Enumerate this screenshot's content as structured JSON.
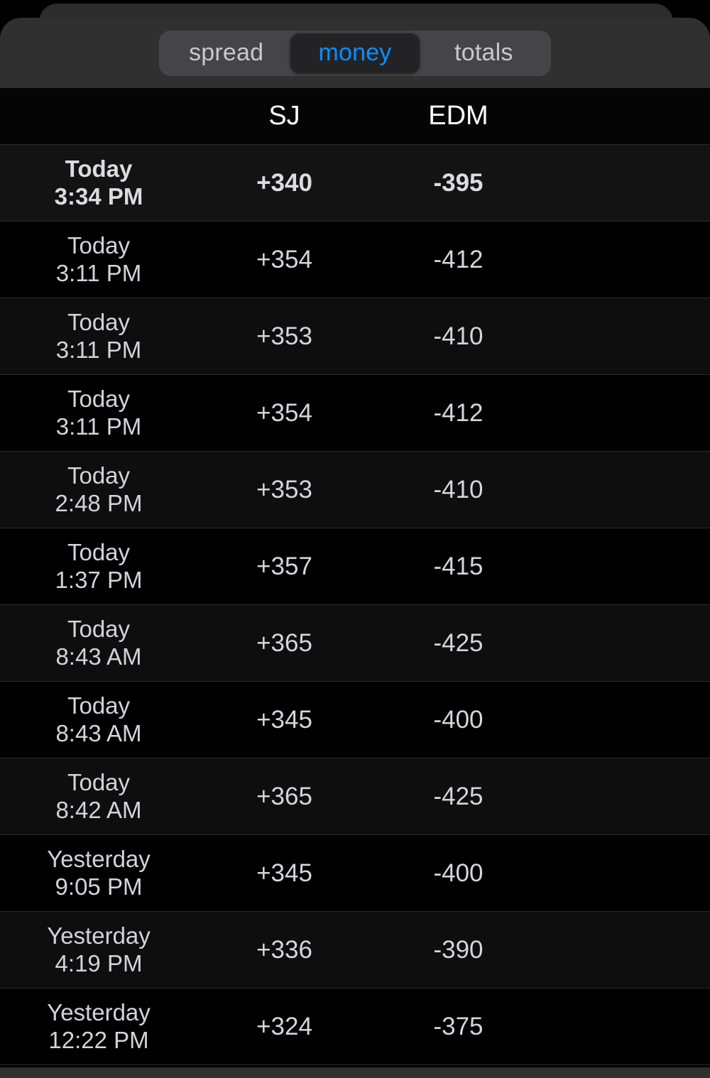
{
  "segmented_control": {
    "options": [
      {
        "label": "spread",
        "selected": false
      },
      {
        "label": "money",
        "selected": true
      },
      {
        "label": "totals",
        "selected": false
      }
    ],
    "selected_value": "money",
    "selected_text_color": "#0a8fff",
    "track_color": "#454547",
    "selected_pill_color": "#232325"
  },
  "table": {
    "columns": [
      "",
      "SJ",
      "EDM"
    ],
    "headers": {
      "date": "",
      "team_1": "SJ",
      "team_2": "EDM"
    },
    "rows": [
      {
        "day": "Today",
        "time": "3:34 PM",
        "sj": "+340",
        "edm": "-395",
        "current": true
      },
      {
        "day": "Today",
        "time": "3:11 PM",
        "sj": "+354",
        "edm": "-412",
        "current": false
      },
      {
        "day": "Today",
        "time": "3:11 PM",
        "sj": "+353",
        "edm": "-410",
        "current": false
      },
      {
        "day": "Today",
        "time": "3:11 PM",
        "sj": "+354",
        "edm": "-412",
        "current": false
      },
      {
        "day": "Today",
        "time": "2:48 PM",
        "sj": "+353",
        "edm": "-410",
        "current": false
      },
      {
        "day": "Today",
        "time": "1:37 PM",
        "sj": "+357",
        "edm": "-415",
        "current": false
      },
      {
        "day": "Today",
        "time": "8:43 AM",
        "sj": "+365",
        "edm": "-425",
        "current": false
      },
      {
        "day": "Today",
        "time": "8:43 AM",
        "sj": "+345",
        "edm": "-400",
        "current": false
      },
      {
        "day": "Today",
        "time": "8:42 AM",
        "sj": "+365",
        "edm": "-425",
        "current": false
      },
      {
        "day": "Yesterday",
        "time": "9:05 PM",
        "sj": "+345",
        "edm": "-400",
        "current": false
      },
      {
        "day": "Yesterday",
        "time": "4:19 PM",
        "sj": "+336",
        "edm": "-390",
        "current": false
      },
      {
        "day": "Yesterday",
        "time": "12:22 PM",
        "sj": "+324",
        "edm": "-375",
        "current": false
      }
    ]
  },
  "theme": {
    "background": "#000000",
    "card_background": "#303030",
    "row_alt_background": "#0e0e0f",
    "accent": "#0a8fff",
    "text_primary": "#ffffff",
    "text_secondary": "#d3d3d8"
  }
}
